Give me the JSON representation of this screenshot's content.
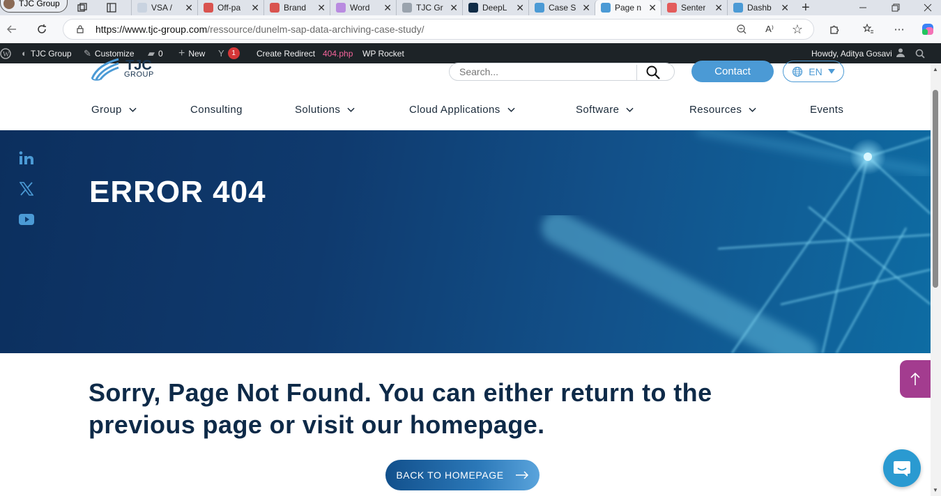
{
  "browser": {
    "profile_tab": "TJC Group",
    "tabs": [
      {
        "title": "VSA /",
        "favicon_color": "#c9d3e0"
      },
      {
        "title": "Off-pa",
        "favicon_color": "#d9534f"
      },
      {
        "title": "Brand",
        "favicon_color": "#d9534f"
      },
      {
        "title": "Word",
        "favicon_color": "#b98be0"
      },
      {
        "title": "TJC Gr",
        "favicon_color": "#9aa3ad"
      },
      {
        "title": "DeepL",
        "favicon_color": "#0f2b46"
      },
      {
        "title": "Case S",
        "favicon_color": "#4b9ad5"
      },
      {
        "title": "Page n",
        "favicon_color": "#4b9ad5",
        "active": true
      },
      {
        "title": "Senter",
        "favicon_color": "#e35b5b"
      },
      {
        "title": "Dashb",
        "favicon_color": "#4b9ad5"
      }
    ],
    "url_host": "https://www.tjc-group.com",
    "url_path": "/ressource/dunelm-sap-data-archiving-case-study/",
    "read_aloud_label": "A⁾"
  },
  "adminbar": {
    "site_name": "TJC Group",
    "customize": "Customize",
    "comments_count": "0",
    "new": "New",
    "yoast_badge": "1",
    "create_redirect": "Create Redirect",
    "template": "404.php",
    "wp_rocket": "WP Rocket",
    "howdy": "Howdy, Aditya Gosavi"
  },
  "header": {
    "logo_text": "TJC",
    "logo_sub": "GROUP",
    "search_placeholder": "Search...",
    "contact": "Contact",
    "language": "EN",
    "menu": [
      {
        "label": "Group",
        "has_dropdown": true
      },
      {
        "label": "Consulting",
        "has_dropdown": false
      },
      {
        "label": "Solutions",
        "has_dropdown": true
      },
      {
        "label": "Cloud Applications",
        "has_dropdown": true
      },
      {
        "label": "Software",
        "has_dropdown": true
      },
      {
        "label": "Resources",
        "has_dropdown": true
      },
      {
        "label": "Events",
        "has_dropdown": false
      }
    ]
  },
  "hero": {
    "title": "ERROR 404",
    "social": [
      "linkedin-icon",
      "x-twitter-icon",
      "youtube-icon"
    ]
  },
  "content": {
    "message": "Sorry, Page Not Found. You can either return to the previous page or visit our homepage.",
    "back_button": "BACK TO HOMEPAGE"
  },
  "colors": {
    "accent": "#4b9ad5",
    "hero_dark": "#0c2f5e",
    "heading": "#0e2a48",
    "scroll_top": "#a33c8f",
    "chat": "#2a9ad1",
    "admin_bar": "#1d2327"
  }
}
